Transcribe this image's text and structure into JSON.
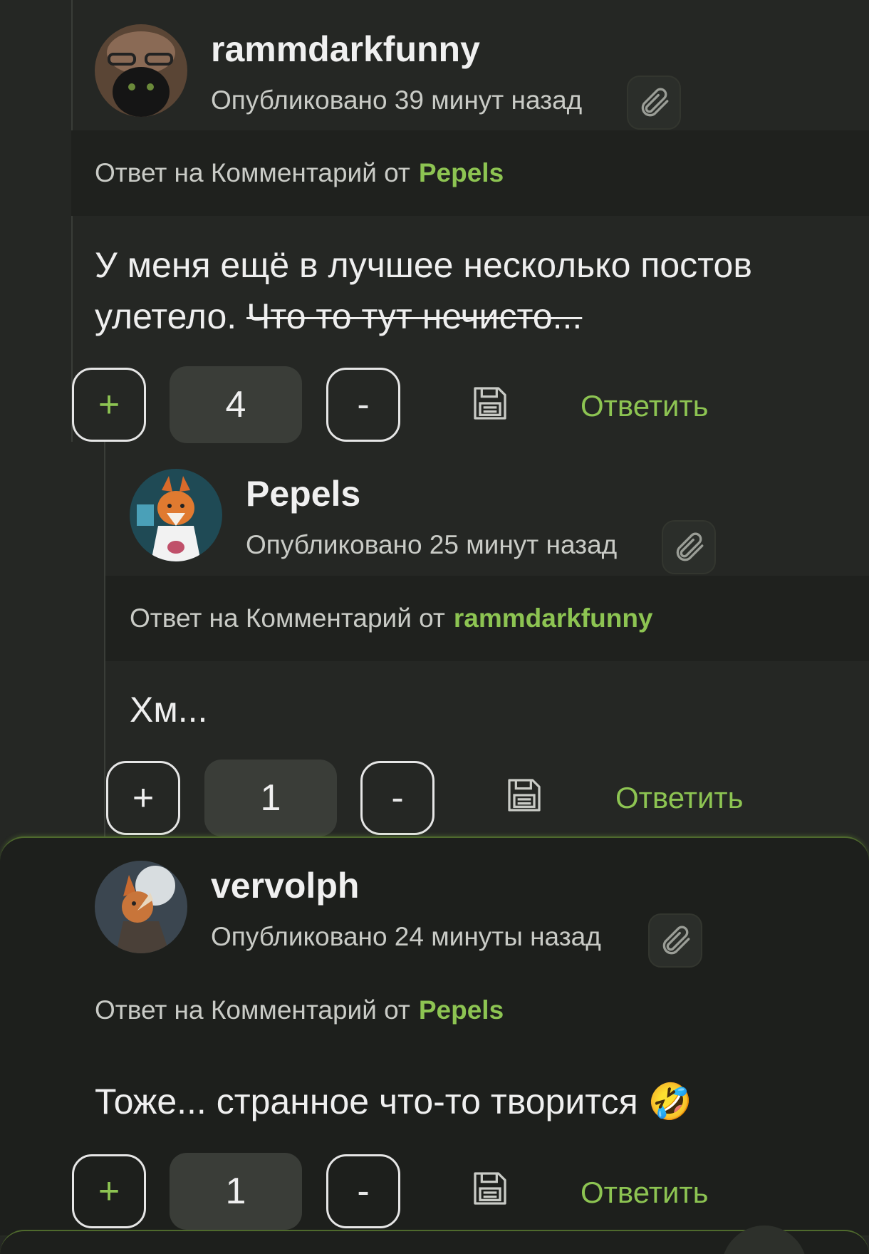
{
  "comments": [
    {
      "author": "rammdarkfunny",
      "published": "Опубликовано 39 минут назад",
      "reply_prefix": "Ответ на Комментарий от",
      "reply_to": "Pepels",
      "text_main": "У меня ещё в лучшее несколько постов улетело.",
      "text_struck": "Что то тут нечисто...",
      "score": "4",
      "plus": "+",
      "minus": "-",
      "reply_label": "Ответить"
    },
    {
      "author": "Pepels",
      "published": "Опубликовано 25 минут назад",
      "reply_prefix": "Ответ на Комментарий от",
      "reply_to": "rammdarkfunny",
      "text_main": "Хм...",
      "score": "1",
      "plus": "+",
      "minus": "-",
      "reply_label": "Ответить"
    },
    {
      "author": "vervolph",
      "published": "Опубликовано 24 минуты назад",
      "reply_prefix": "Ответ на Комментарий от",
      "reply_to": "Pepels",
      "text_main": "Тоже... странное что-то творится 🤣",
      "score": "1",
      "plus": "+",
      "minus": "-",
      "reply_label": "Ответить"
    }
  ],
  "colors": {
    "accent": "#8dc452",
    "background": "#252724",
    "highlight_border": "#4f6a2d"
  },
  "icons": {
    "attach": "paperclip-icon",
    "save": "floppy-disk-icon"
  }
}
